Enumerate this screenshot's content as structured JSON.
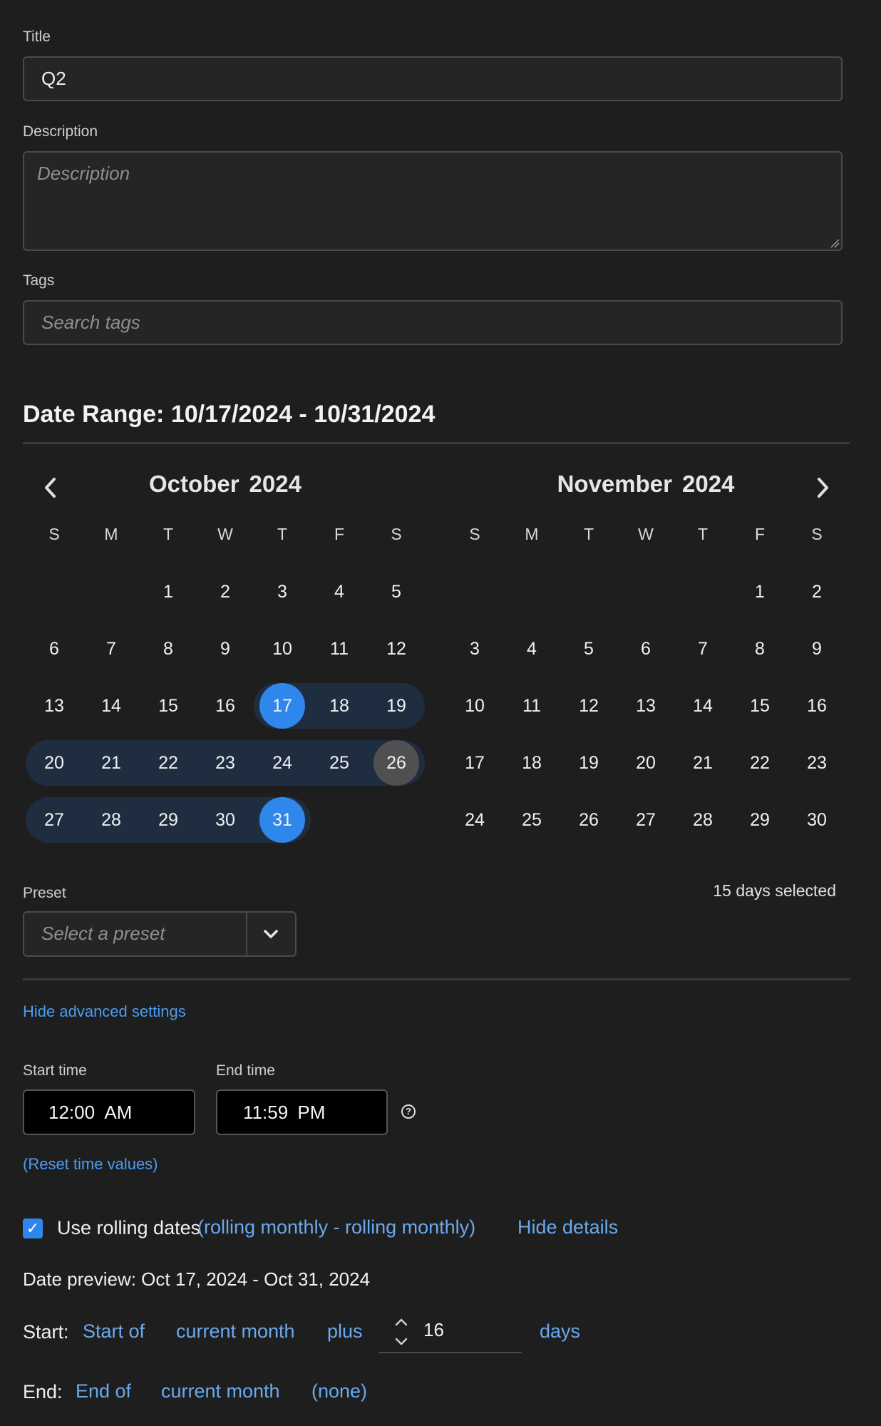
{
  "form": {
    "title_label": "Title",
    "title_value": "Q2",
    "description_label": "Description",
    "description_placeholder": "Description",
    "tags_label": "Tags",
    "tags_placeholder": "Search tags"
  },
  "date_range": {
    "heading": "Date Range: 10/17/2024 - 10/31/2024"
  },
  "calendar": {
    "left": {
      "month": "October",
      "year": "2024"
    },
    "right": {
      "month": "November",
      "year": "2024"
    },
    "weekdays": [
      "S",
      "M",
      "T",
      "W",
      "T",
      "F",
      "S"
    ],
    "october_days": [
      "1",
      "2",
      "3",
      "4",
      "5",
      "6",
      "7",
      "8",
      "9",
      "10",
      "11",
      "12",
      "13",
      "14",
      "15",
      "16",
      "17",
      "18",
      "19",
      "20",
      "21",
      "22",
      "23",
      "24",
      "25",
      "26",
      "27",
      "28",
      "29",
      "30",
      "31"
    ],
    "november_days": [
      "1",
      "2",
      "3",
      "4",
      "5",
      "6",
      "7",
      "8",
      "9",
      "10",
      "11",
      "12",
      "13",
      "14",
      "15",
      "16",
      "17",
      "18",
      "19",
      "20",
      "21",
      "22",
      "23",
      "24",
      "25",
      "26",
      "27",
      "28",
      "29",
      "30"
    ],
    "october_first_weekday": 2,
    "november_first_weekday": 5,
    "selected_start": "17",
    "selected_end": "31",
    "today": "26"
  },
  "preset": {
    "label": "Preset",
    "placeholder": "Select a preset",
    "days_selected": "15 days selected"
  },
  "advanced": {
    "toggle_label": "Hide advanced settings",
    "start_time_label": "Start time",
    "start_time": {
      "hour": "12",
      "minute": "00",
      "period": "AM"
    },
    "end_time_label": "End time",
    "end_time": {
      "hour": "11",
      "minute": "59",
      "period": "PM"
    },
    "reset_label": "(Reset time values)"
  },
  "rolling": {
    "checkbox_label": "Use rolling dates",
    "summary": "(rolling monthly - rolling monthly)",
    "details_toggle": "Hide details",
    "preview": "Date preview: Oct 17, 2024 - Oct 31, 2024",
    "start_label": "Start:",
    "start_anchor": "Start of",
    "start_period": "current month",
    "start_op": "plus",
    "start_offset": "16",
    "start_unit": "days",
    "end_label": "End:",
    "end_anchor": "End of",
    "end_period": "current month",
    "end_op": "(none)"
  },
  "colors": {
    "accent": "#2f87ec",
    "range_band": "#1f2d40",
    "link": "#4c9cf2",
    "background": "#1e1e1e"
  }
}
